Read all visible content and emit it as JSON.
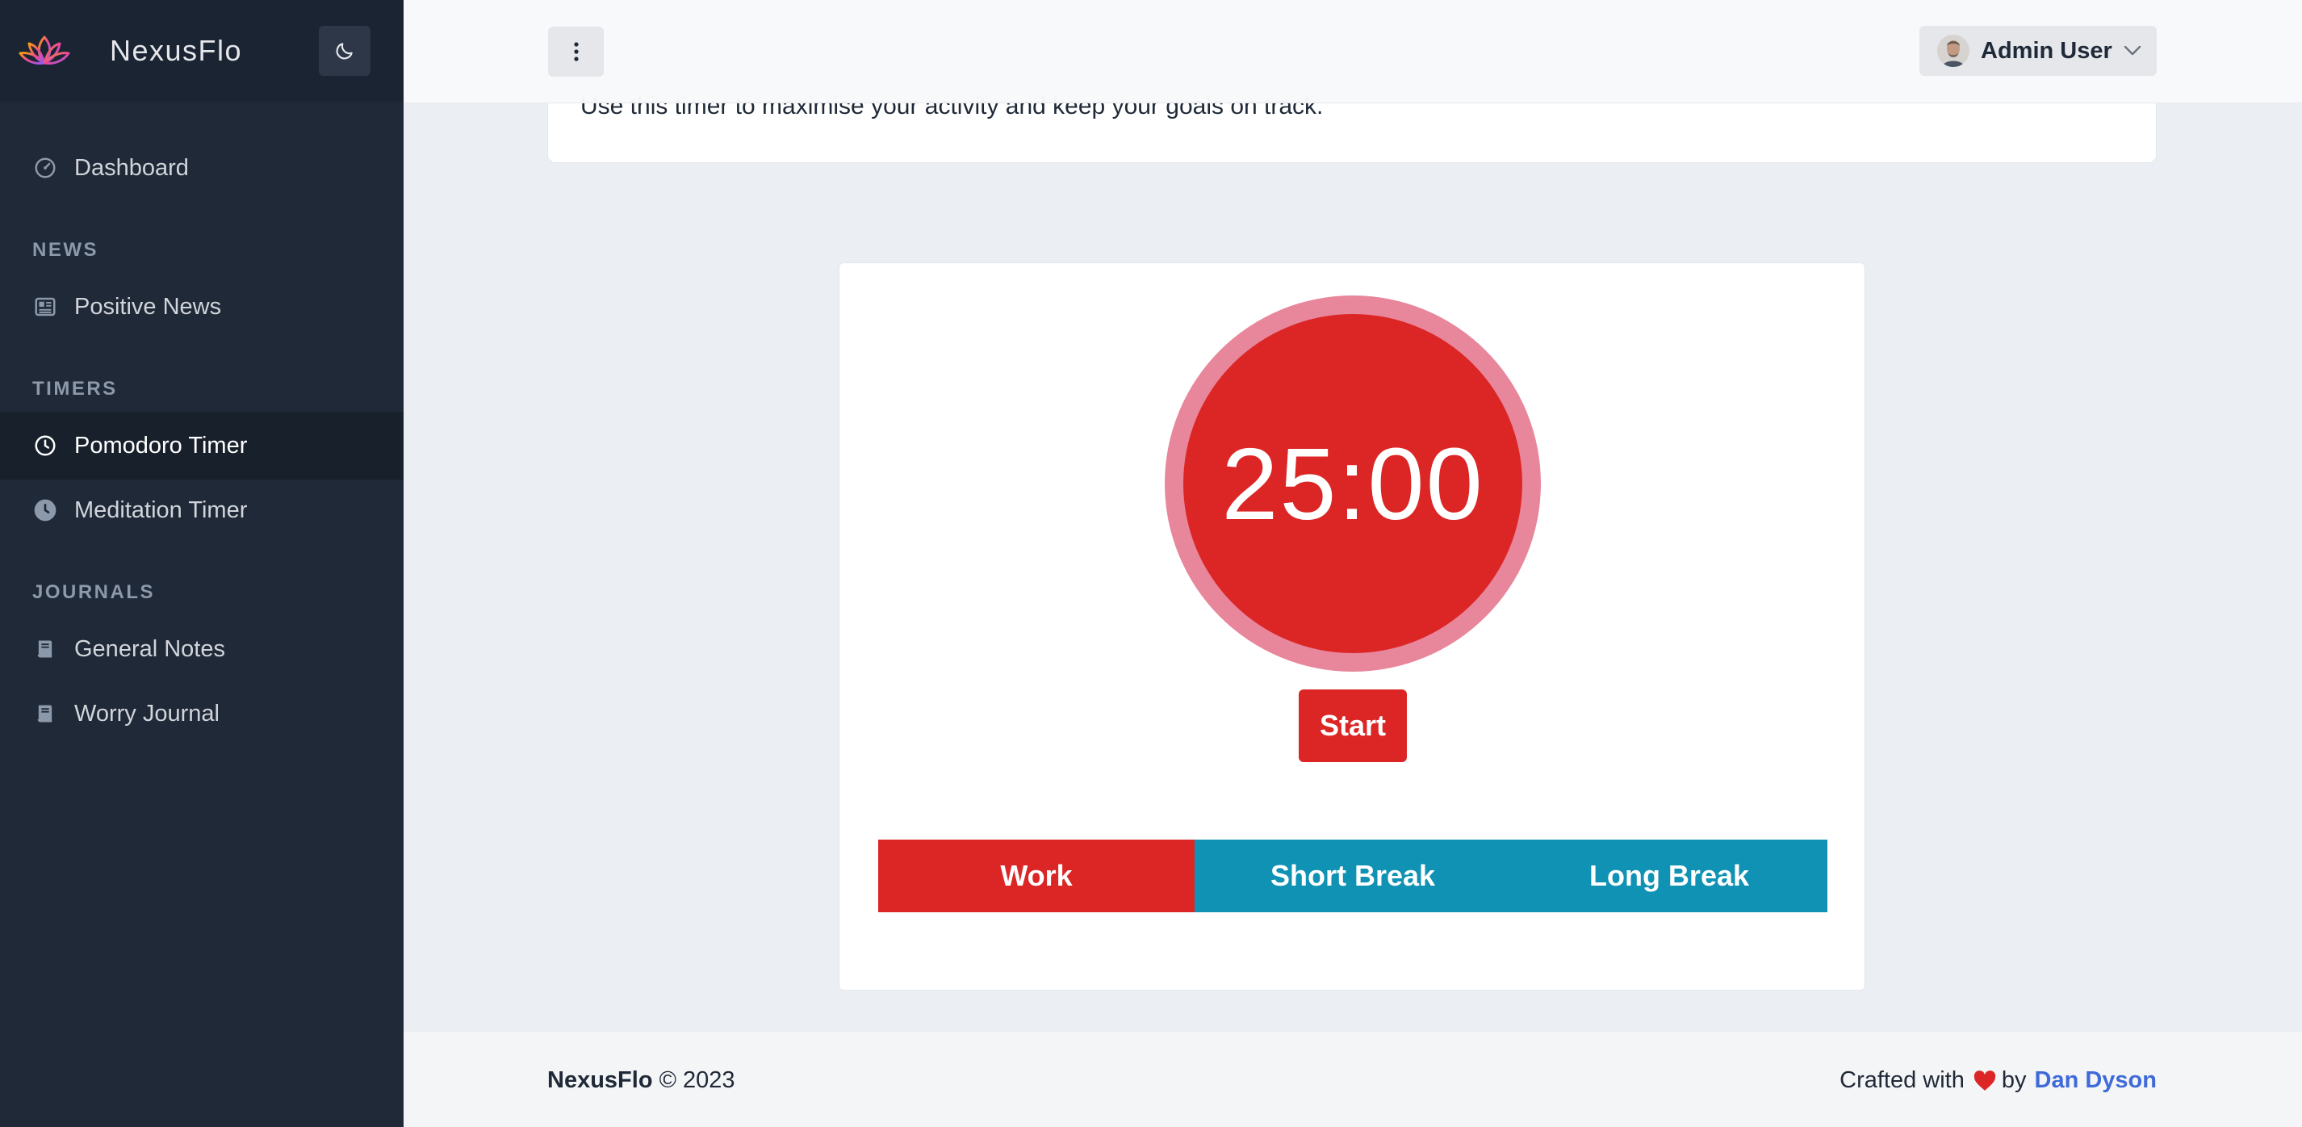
{
  "app": {
    "name": "NexusFlo",
    "colors": {
      "sidebar_bg": "#1f2937",
      "primary_red": "#dc2626",
      "break_blue": "#0f92b4",
      "ring_pink": "#e8869b",
      "link_blue": "#3f6ad8"
    }
  },
  "sidebar": {
    "dashboard": {
      "label": "Dashboard",
      "icon": "gauge-icon"
    },
    "sections": {
      "news": "NEWS",
      "timers": "TIMERS",
      "journals": "JOURNALS"
    },
    "items": {
      "positive_news": {
        "label": "Positive News",
        "icon": "newspaper-icon"
      },
      "pomodoro_timer": {
        "label": "Pomodoro Timer",
        "icon": "clock-icon",
        "active": true
      },
      "meditation_timer": {
        "label": "Meditation Timer",
        "icon": "clock-filled-icon"
      },
      "general_notes": {
        "label": "General Notes",
        "icon": "book-icon"
      },
      "worry_journal": {
        "label": "Worry Journal",
        "icon": "book-icon"
      }
    }
  },
  "header": {
    "user": {
      "name": "Admin User"
    }
  },
  "intro": {
    "text": "Use this timer to maximise your activity and keep your goals on track."
  },
  "timer": {
    "display": "25:00",
    "start_label": "Start",
    "modes": {
      "work": "Work",
      "short_break": "Short Break",
      "long_break": "Long Break"
    },
    "selected_mode": "Work"
  },
  "footer": {
    "brand": "NexusFlo",
    "copyright": "© 2023",
    "crafted_with": "Crafted with",
    "by": "by",
    "author": "Dan Dyson"
  }
}
